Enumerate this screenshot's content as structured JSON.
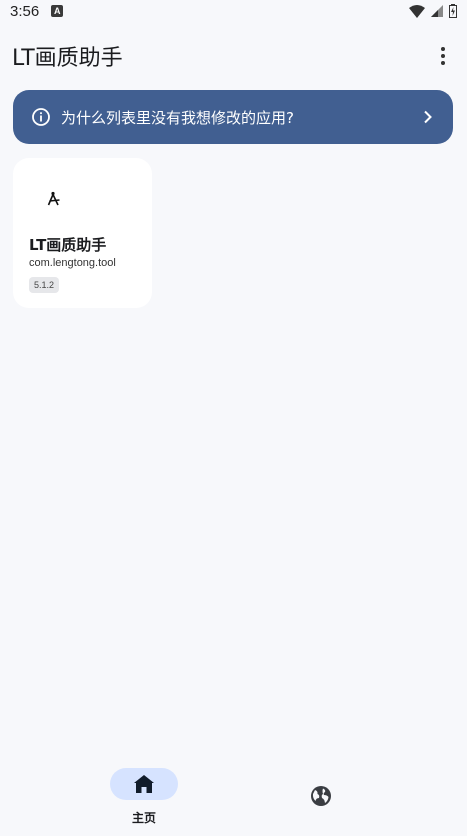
{
  "status_bar": {
    "time": "3:56",
    "notification_icon": "a-letter-icon",
    "icons": [
      "wifi-icon",
      "signal-icon",
      "battery-icon"
    ]
  },
  "app_bar": {
    "title": "LT画质助手",
    "menu_icon": "more-vert-icon"
  },
  "banner": {
    "text": "为什么列表里没有我想修改的应用?",
    "icon": "info-icon",
    "trailing_icon": "chevron-right-icon",
    "background": "#415f91"
  },
  "apps": [
    {
      "name": "LT画质助手",
      "package": "com.lengtong.tool",
      "version": "5.1.2",
      "icon": "compass-drafting-icon"
    }
  ],
  "bottom_nav": {
    "items": [
      {
        "label": "主页",
        "icon": "home-icon",
        "selected": true
      },
      {
        "label": "",
        "icon": "globe-icon",
        "selected": false
      }
    ],
    "selected_color": "#d6e3ff"
  }
}
